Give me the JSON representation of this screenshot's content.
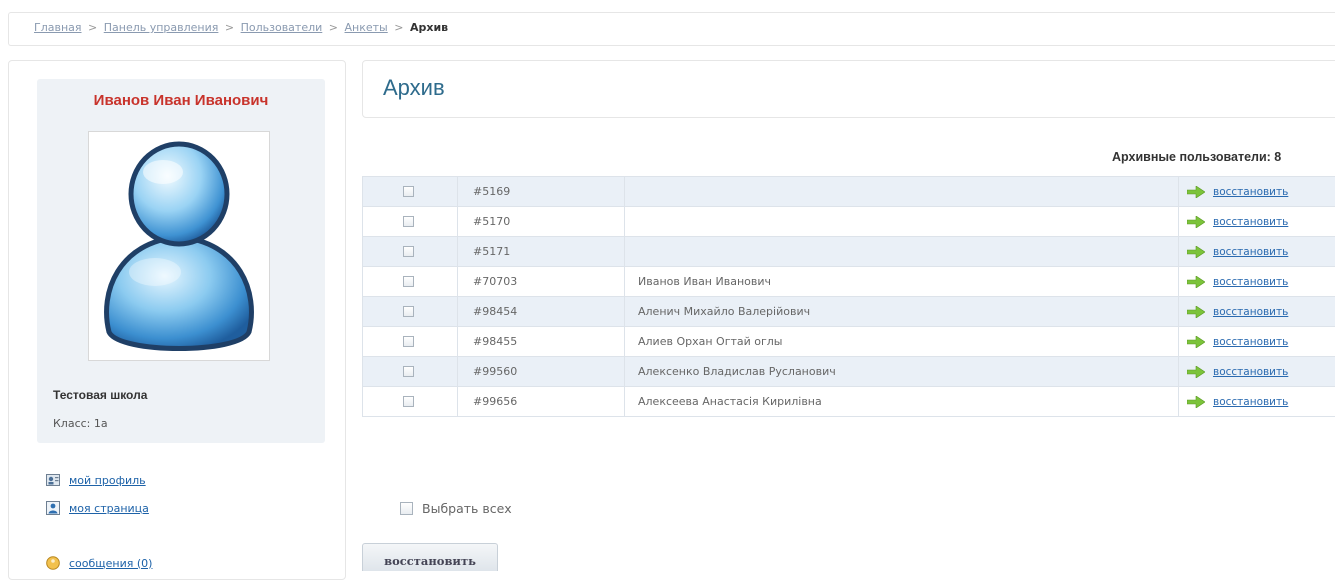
{
  "breadcrumb": {
    "items": [
      "Главная",
      "Панель управления",
      "Пользователи",
      "Анкеты"
    ],
    "separator": ">",
    "current": "Архив"
  },
  "profile": {
    "name": "Иванов Иван Иванович",
    "school": "Тестовая школа",
    "class_line": "Класс: 1а"
  },
  "side_links": [
    {
      "label": "мой профиль",
      "icon": "profile-icon"
    },
    {
      "label": "моя страница",
      "icon": "user-page-icon"
    },
    {
      "label": "сообщения (0)",
      "icon": "messages-icon"
    }
  ],
  "page": {
    "title": "Архив",
    "count_label": "Архивные пользователи: 8"
  },
  "table": {
    "action_label": "восстановить",
    "rows": [
      {
        "id": "#5169",
        "name": ""
      },
      {
        "id": "#5170",
        "name": ""
      },
      {
        "id": "#5171",
        "name": ""
      },
      {
        "id": "#70703",
        "name": "Иванов Иван Иванович"
      },
      {
        "id": "#98454",
        "name": "Аленич Михайло Валерійович"
      },
      {
        "id": "#98455",
        "name": "Алиев Орхан Огтай оглы"
      },
      {
        "id": "#99560",
        "name": "Алексенко Владислав Русланович"
      },
      {
        "id": "#99656",
        "name": "Алексеева Анастасія Кирилівна"
      }
    ]
  },
  "select_all_label": "Выбрать всех",
  "restore_button_label": "восстановить",
  "colors": {
    "accent_name": "#c8332b",
    "title": "#2e6b8c",
    "link": "#1d62a8",
    "row_alt": "#eaf0f7",
    "arrow": "#7cc33a"
  }
}
